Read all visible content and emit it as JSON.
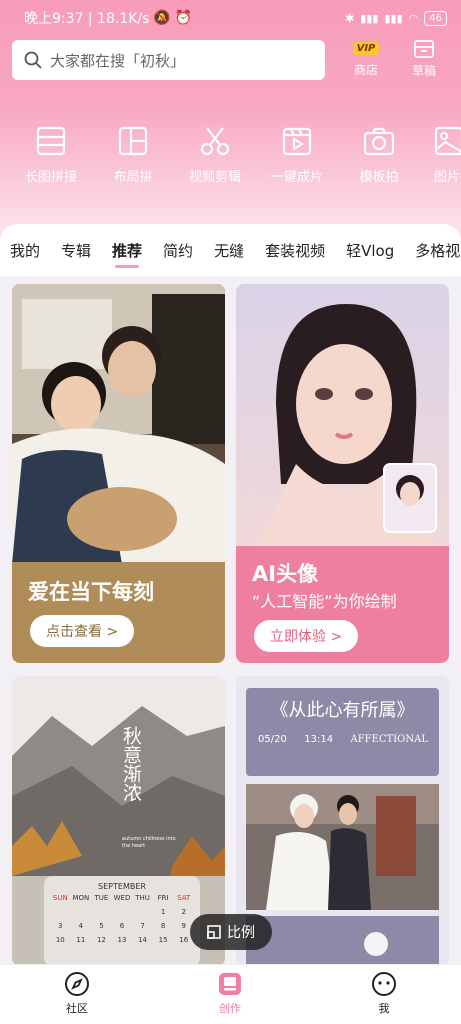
{
  "status_bar": {
    "left": "晚上9:37 | 18.1K/s",
    "battery": "46"
  },
  "search": {
    "placeholder": "大家都在搜「初秋」"
  },
  "header_buttons": {
    "store_label": "商店",
    "vip_badge": "VIP",
    "draft_label": "草稿"
  },
  "tools": [
    {
      "label": "长图拼接",
      "icon": "long-image-icon"
    },
    {
      "label": "布局拼",
      "icon": "layout-icon"
    },
    {
      "label": "视频剪辑",
      "icon": "scissors-icon"
    },
    {
      "label": "一键成片",
      "icon": "one-click-video-icon"
    },
    {
      "label": "模板拍",
      "icon": "camera-icon"
    },
    {
      "label": "图片",
      "icon": "image-icon"
    }
  ],
  "tabs": [
    "我的",
    "专辑",
    "推荐",
    "简约",
    "无缝",
    "套装视频",
    "轻Vlog",
    "多格视"
  ],
  "active_tab": "推荐",
  "cards": {
    "card1": {
      "title": "爱在当下每刻",
      "button": "点击查看 >"
    },
    "card2": {
      "title": "AI头像",
      "subtitle": "“人工智能”为你绘制",
      "button": "立即体验 >"
    },
    "card3": {
      "calligraphy": "秋意渐浓",
      "tiny_caption": "autumn chillness into the heart",
      "calendar_month": "SEPTEMBER",
      "calendar_days": [
        "SUN",
        "MON",
        "TUE",
        "WED",
        "THU",
        "FRI",
        "SAT"
      ],
      "calendar_rows": [
        [
          "",
          "",
          "",
          "",
          "",
          "1",
          "2"
        ],
        [
          "3",
          "4",
          "5",
          "6",
          "7",
          "8",
          "9"
        ],
        [
          "10",
          "11",
          "12",
          "13",
          "14",
          "15",
          "16"
        ]
      ]
    },
    "card4": {
      "title": "《从此心有所属》",
      "date": "05/20",
      "time": "13:14",
      "word": "AFFECTIONAL"
    }
  },
  "ratio_button": "比例",
  "bottom_nav": [
    {
      "label": "社区",
      "icon": "compass-icon"
    },
    {
      "label": "创作",
      "icon": "create-icon"
    },
    {
      "label": "我",
      "icon": "smiley-icon"
    }
  ],
  "colors": {
    "header_pink": "#f79cb9",
    "card1_banner": "#b08d58",
    "card2_banner": "#ee7f9f",
    "accent": "#f27ea4"
  }
}
